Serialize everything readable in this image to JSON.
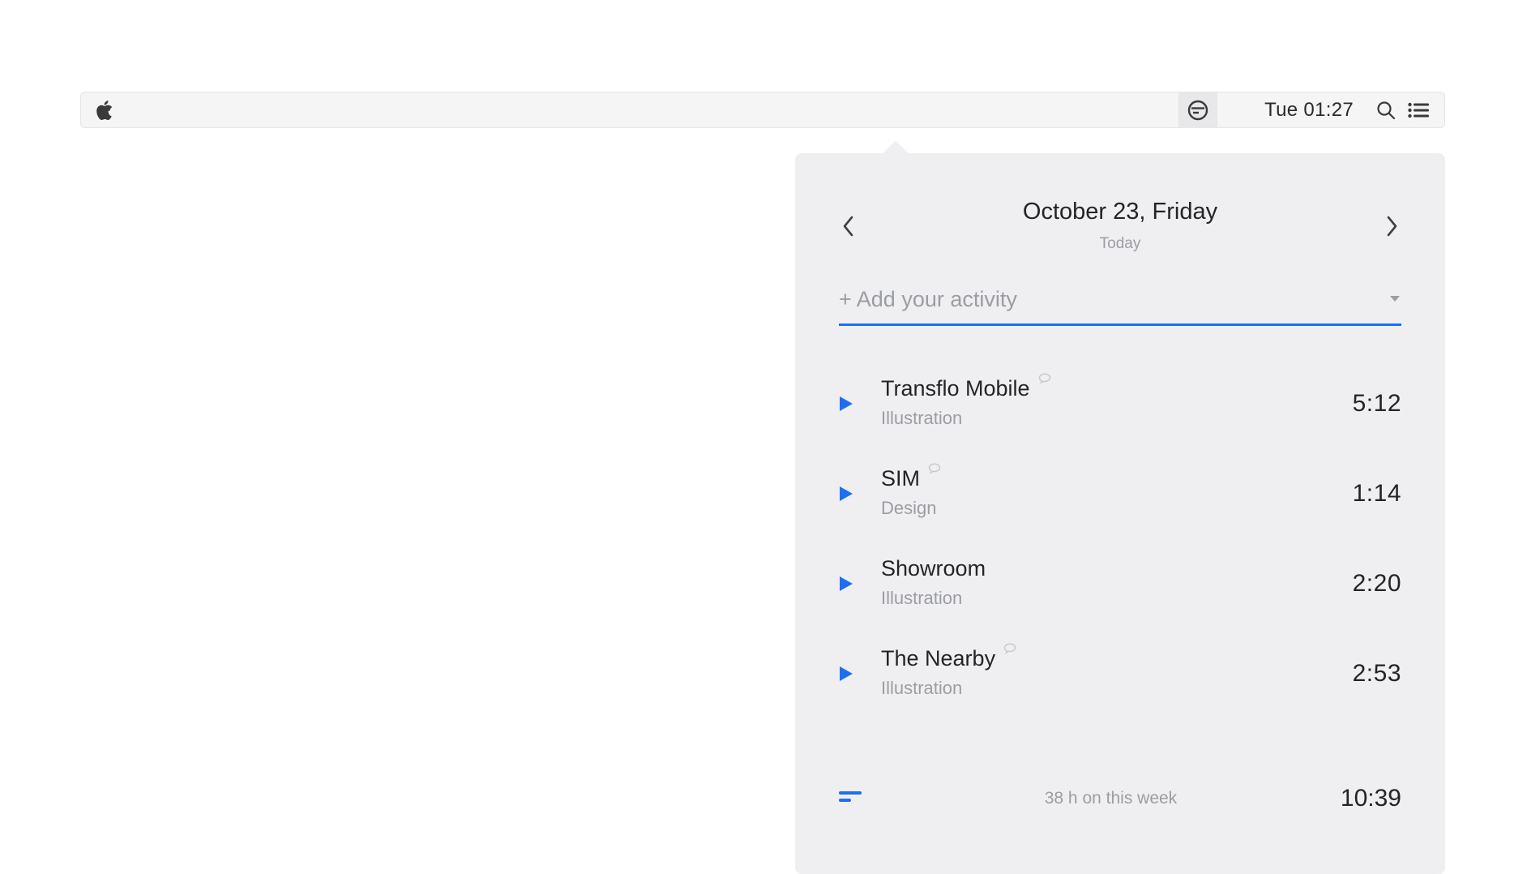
{
  "menubar": {
    "time": "Tue 01:27"
  },
  "panel": {
    "date_title": "October 23, Friday",
    "date_subtitle": "Today",
    "add_placeholder": "+ Add your activity",
    "entries": [
      {
        "title": "Transflo Mobile",
        "category": "Illustration",
        "duration": "5:12",
        "has_comment": true
      },
      {
        "title": "SIM",
        "category": "Design",
        "duration": "1:14",
        "has_comment": true
      },
      {
        "title": "Showroom",
        "category": "Illustration",
        "duration": "2:20",
        "has_comment": false
      },
      {
        "title": "The Nearby",
        "category": "Illustration",
        "duration": "2:53",
        "has_comment": true
      }
    ],
    "footer_text": "38 h on this week",
    "footer_total": "10:39"
  }
}
